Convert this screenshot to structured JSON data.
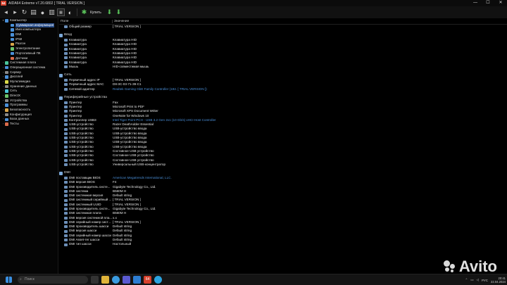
{
  "window": {
    "app_icon_text": "64",
    "title": "AIDA64 Extreme v7.20.6802  [ TRIAL VERSION ]",
    "minimize": "—",
    "maximize": "☐",
    "close": "✕"
  },
  "toolbar": {
    "buy_label": "Купить"
  },
  "tree": {
    "items": [
      {
        "label": "Компьютер",
        "depth": 0,
        "expanded": true,
        "color": "#4a90d9"
      },
      {
        "label": "Суммарная информация",
        "depth": 1,
        "selected": true,
        "color": "#4a90d9"
      },
      {
        "label": "Имя компьютера",
        "depth": 1,
        "color": "#4a90d9"
      },
      {
        "label": "DMI",
        "depth": 1,
        "color": "#4a90d9"
      },
      {
        "label": "IPMI",
        "depth": 1,
        "color": "#4a90d9"
      },
      {
        "label": "Разгон",
        "depth": 1,
        "color": "#d9a64a"
      },
      {
        "label": "Электропитание",
        "depth": 1,
        "color": "#6ac46a"
      },
      {
        "label": "Портативный ПК",
        "depth": 1,
        "color": "#4a90d9"
      },
      {
        "label": "Датчики",
        "depth": 1,
        "color": "#d96a4a"
      },
      {
        "label": "Системная плата",
        "depth": 0,
        "color": "#4ac49a"
      },
      {
        "label": "Операционная система",
        "depth": 0,
        "color": "#4a90d9"
      },
      {
        "label": "Сервер",
        "depth": 0,
        "color": "#8a8a8a"
      },
      {
        "label": "Дисплей",
        "depth": 0,
        "color": "#4a90d9"
      },
      {
        "label": "Мультимедиа",
        "depth": 0,
        "color": "#d9d94a"
      },
      {
        "label": "Хранение данных",
        "depth": 0,
        "color": "#8a8a8a"
      },
      {
        "label": "Сеть",
        "depth": 0,
        "color": "#4ac4d9"
      },
      {
        "label": "DirectX",
        "depth": 0,
        "color": "#6ac46a"
      },
      {
        "label": "Устройства",
        "depth": 0,
        "color": "#8a8a8a"
      },
      {
        "label": "Программы",
        "depth": 0,
        "color": "#4a90d9"
      },
      {
        "label": "Безопасность",
        "depth": 0,
        "color": "#d9a64a"
      },
      {
        "label": "Конфигурация",
        "depth": 0,
        "color": "#8a8a8a"
      },
      {
        "label": "База данных",
        "depth": 0,
        "color": "#4a90d9"
      },
      {
        "label": "Тесты",
        "depth": 0,
        "color": "#d96a4a"
      }
    ]
  },
  "main": {
    "col_field": "Поле",
    "col_value": "Значение",
    "blocks": [
      {
        "rows": [
          {
            "field": "Общий размер",
            "value": "[ TRIAL VERSION ]"
          }
        ]
      },
      {
        "title": "Ввод",
        "rows": [
          {
            "field": "Клавиатура",
            "value": "Клавиатура HID"
          },
          {
            "field": "Клавиатура",
            "value": "Клавиатура HID"
          },
          {
            "field": "Клавиатура",
            "value": "Клавиатура HID"
          },
          {
            "field": "Клавиатура",
            "value": "Клавиатура HID"
          },
          {
            "field": "Клавиатура",
            "value": "Клавиатура HID"
          },
          {
            "field": "Клавиатура",
            "value": "Клавиатура HID"
          },
          {
            "field": "Мышь",
            "value": "HID-совместимая мышь"
          }
        ]
      },
      {
        "title": "Сеть",
        "rows": [
          {
            "field": "Первичный адрес IP",
            "value": "[ TRIAL VERSION ]"
          },
          {
            "field": "Первичный адрес MAC",
            "value": "D8-3C-03-71-39-C1"
          },
          {
            "field": "Сетевой адаптер",
            "value": "Realtek Gaming GbE Family Controller (192. [ TRIAL VERSION ])",
            "link": true
          }
        ]
      },
      {
        "title": "Периферийные устройства",
        "rows": [
          {
            "field": "Принтер",
            "value": "Fax"
          },
          {
            "field": "Принтер",
            "value": "Microsoft Print to PDF"
          },
          {
            "field": "Принтер",
            "value": "Microsoft XPS Document Writer"
          },
          {
            "field": "Принтер",
            "value": "OneNote for Windows 10"
          },
          {
            "field": "Контроллер USB3",
            "value": "Intel Tiger Point PCH - USB 3.2 Gen 2x1 (10 Gb/s) xHCI Host Controller",
            "link": true
          },
          {
            "field": "USB-устройство",
            "value": "Razer DeathAdder Essential"
          },
          {
            "field": "USB-устройство",
            "value": "USB-устройство ввода"
          },
          {
            "field": "USB-устройство",
            "value": "USB-устройство ввода"
          },
          {
            "field": "USB-устройство",
            "value": "USB-устройство ввода"
          },
          {
            "field": "USB-устройство",
            "value": "USB-устройство ввода"
          },
          {
            "field": "USB-устройство",
            "value": "USB-устройство ввода"
          },
          {
            "field": "USB-устройство",
            "value": "Составное USB устройство"
          },
          {
            "field": "USB-устройство",
            "value": "Составное USB устройство"
          },
          {
            "field": "USB-устройство",
            "value": "Составное USB устройство"
          },
          {
            "field": "USB-устройство",
            "value": "Универсальный USB-концентратор"
          }
        ]
      },
      {
        "title": "DMI",
        "rows": [
          {
            "field": "DMI поставщик BIOS",
            "value": "American Megatrends International, LLC.",
            "link": true
          },
          {
            "field": "DMI версия BIOS",
            "value": "F4"
          },
          {
            "field": "DMI производитель систе...",
            "value": "Gigabyte Technology Co., Ltd."
          },
          {
            "field": "DMI система",
            "value": "B560M H"
          },
          {
            "field": "DMI системная версия",
            "value": "Default string"
          },
          {
            "field": "DMI системный серийный ...",
            "value": "[ TRIAL VERSION ]"
          },
          {
            "field": "DMI системный UUID",
            "value": "[ TRIAL VERSION ]"
          },
          {
            "field": "DMI производитель систе...",
            "value": "Gigabyte Technology Co., Ltd."
          },
          {
            "field": "DMI системная плата",
            "value": "B560M H"
          },
          {
            "field": "DMI версия системной пла...",
            "value": "x.x"
          },
          {
            "field": "DMI серийный номер сист...",
            "value": "[ TRIAL VERSION ]"
          },
          {
            "field": "DMI производитель шасси",
            "value": "Default string"
          },
          {
            "field": "DMI версия шасси",
            "value": "Default string"
          },
          {
            "field": "DMI серийный номер шасси",
            "value": "Default string"
          },
          {
            "field": "DMI Asset-тег шасси",
            "value": "Default string"
          },
          {
            "field": "DMI тип шасси",
            "value": "Настольный"
          }
        ]
      }
    ]
  },
  "taskbar": {
    "search_placeholder": "Поиск",
    "lang": "РУС",
    "time": "20:41",
    "date": "22.04.2024"
  },
  "watermark": {
    "text": "Avito"
  }
}
